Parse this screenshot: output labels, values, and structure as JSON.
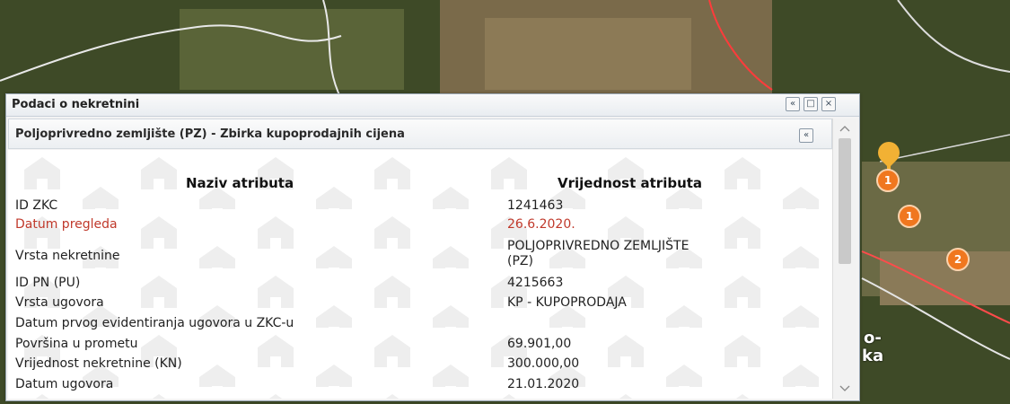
{
  "panel": {
    "title": "Podaci o nekretnini",
    "buttons": {
      "collapse": "«",
      "maximize": "□",
      "close": "×"
    }
  },
  "section": {
    "title": "Poljoprivredno zemljište (PZ) - Zbirka kupoprodajnih cijena",
    "collapse": "«"
  },
  "table": {
    "header_name": "Naziv atributa",
    "header_value": "Vrijednost atributa",
    "rows": [
      {
        "name": "ID ZKC",
        "value": "1241463"
      },
      {
        "name": "Datum pregleda",
        "value": "26.6.2020."
      },
      {
        "name": "Vrsta nekretnine",
        "value": "POLJOPRIVREDNO ZEMLJIŠTE",
        "value2": "(PZ)"
      },
      {
        "name": "ID PN (PU)",
        "value": "4215663"
      },
      {
        "name": "Vrsta ugovora",
        "value": "KP - KUPOPRODAJA"
      },
      {
        "name": "Datum prvog evidentiranja ugovora u ZKC-u",
        "value": ""
      },
      {
        "name": "Površina u prometu",
        "value": "69.901,00"
      },
      {
        "name": "Vrijednost nekretnine (KN)",
        "value": "300.000,00"
      },
      {
        "name": "Datum ugovora",
        "value": "21.01.2020"
      }
    ]
  },
  "map": {
    "markers": [
      "1",
      "1",
      "2"
    ],
    "labels": [
      "o-",
      "ka"
    ],
    "colors": {
      "marker": "#f0771f",
      "pin": "#f2b134",
      "accent_text": "#c0392b"
    }
  },
  "scrollbar": {
    "up_icon": "chevron-up-icon",
    "down_icon": "chevron-down-icon"
  }
}
